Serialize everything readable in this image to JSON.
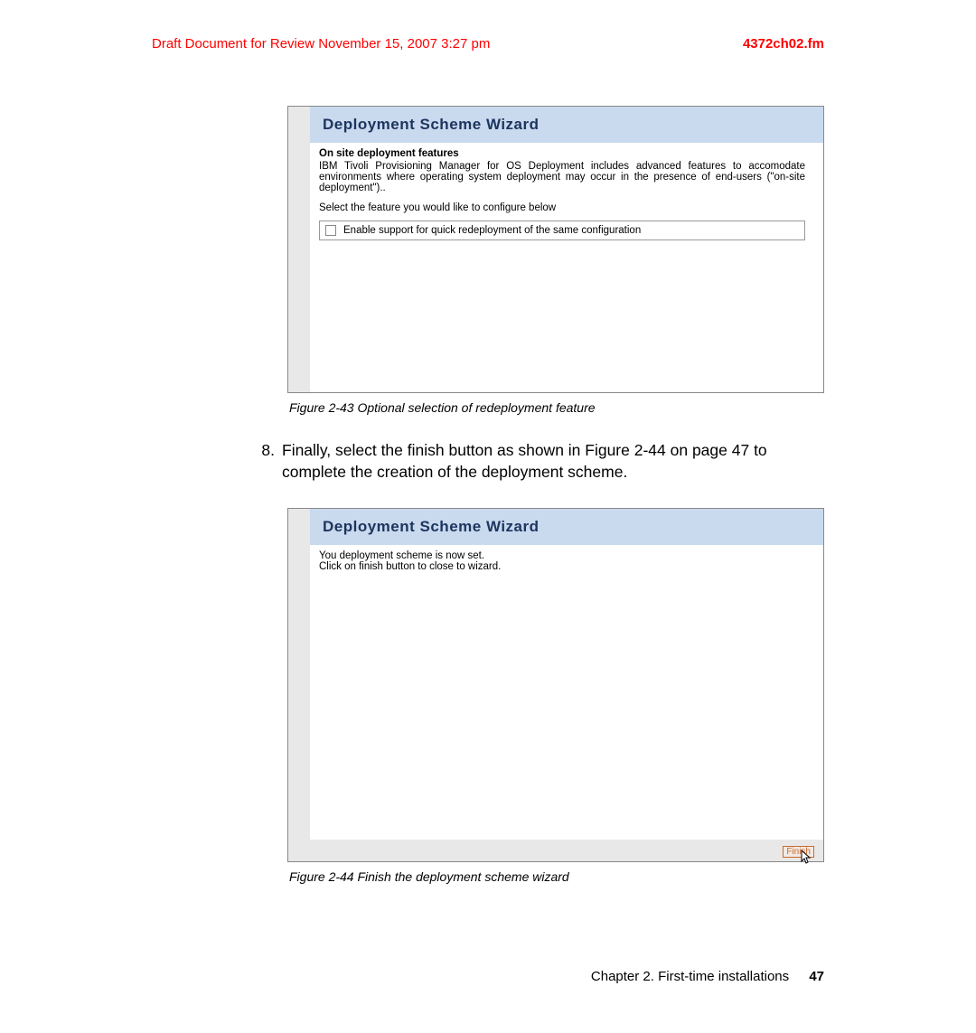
{
  "header": {
    "left": "Draft Document for Review November 15, 2007 3:27 pm",
    "right": "4372ch02.fm"
  },
  "figure1": {
    "wizard_title": "Deployment Scheme Wizard",
    "subheading": "On site deployment features",
    "para1": "IBM Tivoli Provisioning Manager for OS Deployment includes advanced features to accomodate environments where operating system deployment may occur in the presence of end-users (\"on-site deployment\")..",
    "para2": "Select the feature you would like to configure below",
    "checkbox_label": "Enable support for quick redeployment of the same configuration",
    "caption": "Figure 2-43   Optional selection of redeployment feature"
  },
  "step": {
    "num": "8.",
    "text": "Finally, select the finish button as shown in Figure 2-44 on page 47 to complete the creation of the deployment scheme."
  },
  "figure2": {
    "wizard_title": "Deployment Scheme Wizard",
    "line1": "You deployment scheme is now set.",
    "line2": "Click on finish button to close to wizard.",
    "finish_label": "Finish",
    "caption": "Figure 2-44   Finish the deployment scheme wizard"
  },
  "footer": {
    "chapter": "Chapter 2. First-time installations",
    "page": "47"
  }
}
